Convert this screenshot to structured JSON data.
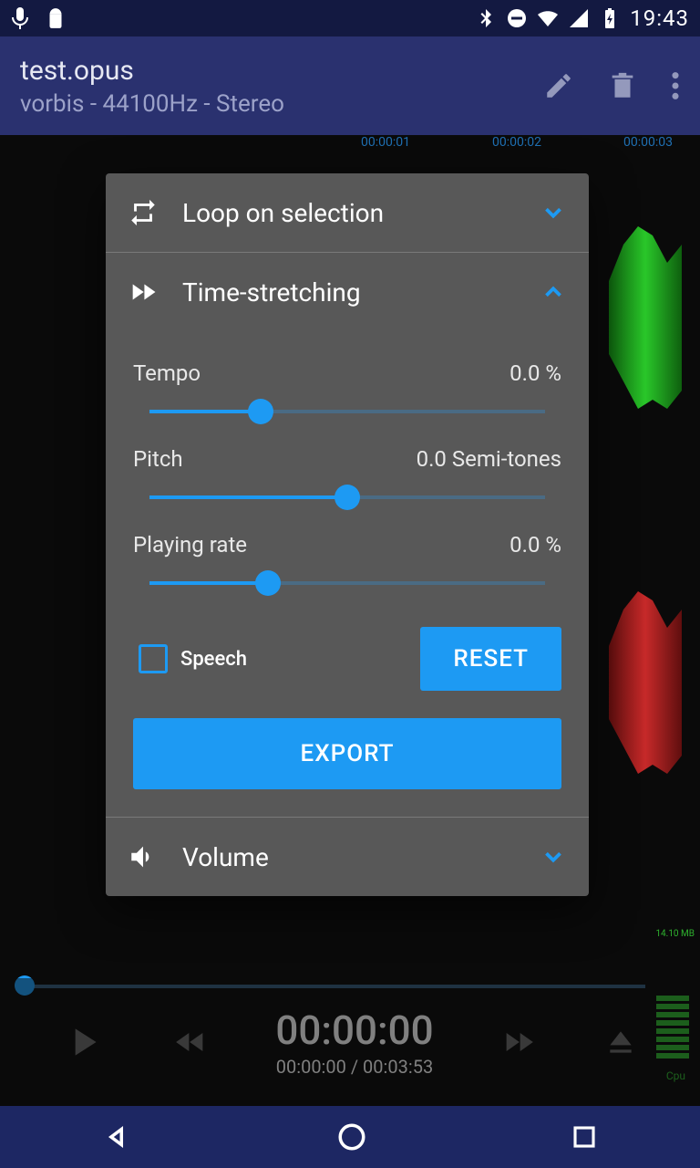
{
  "status": {
    "time": "19:43"
  },
  "appbar": {
    "title": "test.opus",
    "subtitle": "vorbis - 44100Hz - Stereo"
  },
  "ruler": {
    "t1": "00:00:01",
    "t2": "00:00:02",
    "t3": "00:00:03"
  },
  "panel": {
    "loop": {
      "title": "Loop on selection"
    },
    "stretch": {
      "title": "Time-stretching",
      "tempo": {
        "label": "Tempo",
        "value": "0.0 %",
        "fill": 28
      },
      "pitch": {
        "label": "Pitch",
        "value": "0.0 Semi-tones",
        "fill": 50
      },
      "rate": {
        "label": "Playing rate",
        "value": "0.0 %",
        "fill": 30
      },
      "speech": "Speech",
      "reset": "RESET",
      "export": "EXPORT"
    },
    "volume": {
      "title": "Volume"
    }
  },
  "transport": {
    "time_main": "00:00:00",
    "time_sub": "00:00:00 / 00:03:53"
  },
  "meters": {
    "mem": "14.10 MB",
    "cpu": "Cpu"
  }
}
